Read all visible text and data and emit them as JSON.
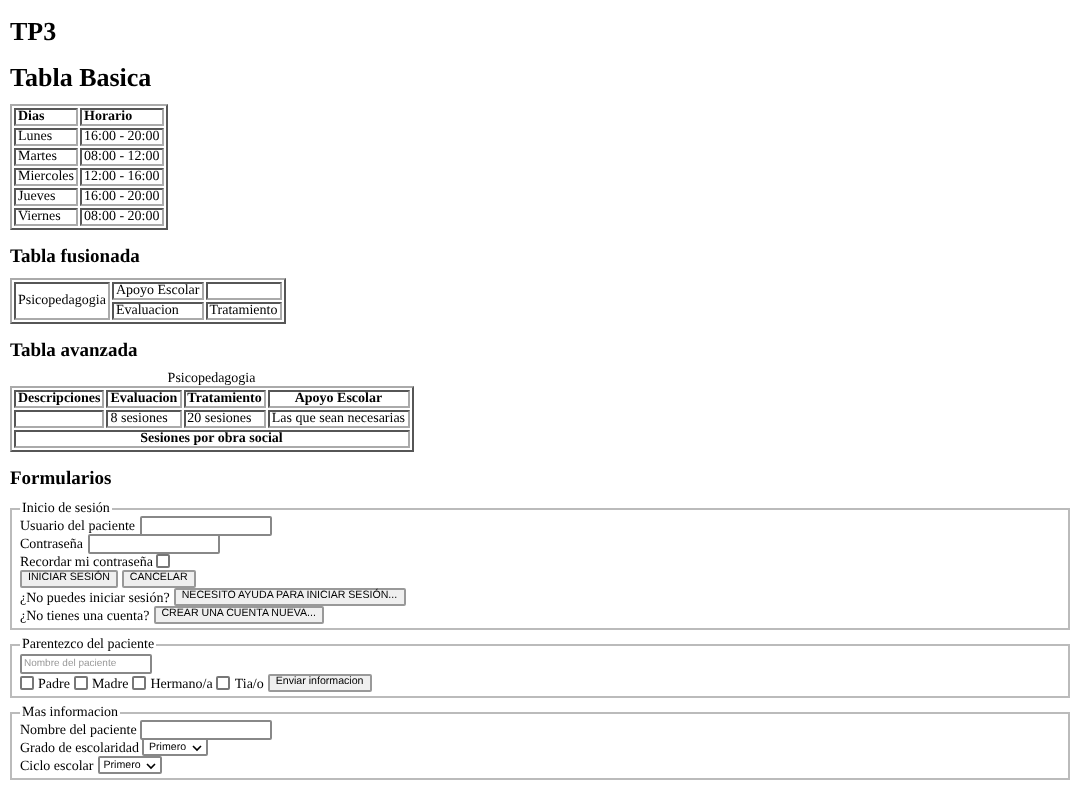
{
  "title": "TP3",
  "basic_table": {
    "title": "Tabla Basica",
    "columns": [
      "Dias",
      "Horario"
    ],
    "rows": [
      [
        "Lunes",
        "16:00 - 20:00"
      ],
      [
        "Martes",
        "08:00 - 12:00"
      ],
      [
        "Miercoles",
        "12:00 - 16:00"
      ],
      [
        "Jueves",
        "16:00 - 20:00"
      ],
      [
        "Viernes",
        "08:00 - 20:00"
      ]
    ]
  },
  "merged_table": {
    "title": "Tabla fusionada",
    "row_header": "Psicopedagogia",
    "top_cell": "Apoyo Escolar",
    "bottom_cells": [
      "Evaluacion",
      "Tratamiento"
    ]
  },
  "advanced_table": {
    "title": "Tabla avanzada",
    "caption": "Psicopedagogia",
    "columns": [
      "Descripciones",
      "Evaluacion",
      "Tratamiento",
      "Apoyo Escolar"
    ],
    "row_values": [
      "8 sesiones",
      "20 sesiones",
      "Las que sean necesarias"
    ],
    "footer": "Sesiones por obra social"
  },
  "forms": {
    "title": "Formularios",
    "fieldsets": [
      {
        "legend": "Inicio de sesión",
        "lines": [
          {
            "kind": "text",
            "label": "Usuario del paciente"
          },
          {
            "kind": "text",
            "label": "Contraseña"
          },
          {
            "kind": "checkbox",
            "label": "Recordar mi contraseña",
            "checked": false
          },
          {
            "kind": "buttons",
            "buttons": [
              "INICIAR SESIÓN",
              "CANCELAR"
            ]
          },
          {
            "kind": "prompt",
            "label": "¿No puedes iniciar sesión?",
            "buttons": [
              "NECESITO AYUDA PARA INICIAR SESIÓN..."
            ]
          },
          {
            "kind": "prompt",
            "label": "¿No tienes una cuenta?",
            "buttons": [
              "CREAR UNA CUENTA NUEVA..."
            ]
          }
        ]
      },
      {
        "legend": "Parentezco del paciente",
        "lines": [
          {
            "kind": "placeholder",
            "placeholder": "Nombre del paciente"
          },
          {
            "kind": "checkgroup",
            "options": [
              {
                "label": "Padre",
                "checked": false
              },
              {
                "label": "Madre",
                "checked": false
              },
              {
                "label": "Hermano/a",
                "checked": false
              },
              {
                "label": "Tia/o",
                "checked": false
              }
            ],
            "buttons": [
              "Enviar informacion"
            ]
          }
        ]
      },
      {
        "legend": "Mas informacion",
        "lines": [
          {
            "kind": "text",
            "label": "Nombre del paciente"
          },
          {
            "kind": "select",
            "label": "Grado de escolaridad",
            "value": "Primero"
          },
          {
            "kind": "select",
            "label": "Ciclo escolar",
            "value": "Primero"
          }
        ]
      }
    ]
  }
}
